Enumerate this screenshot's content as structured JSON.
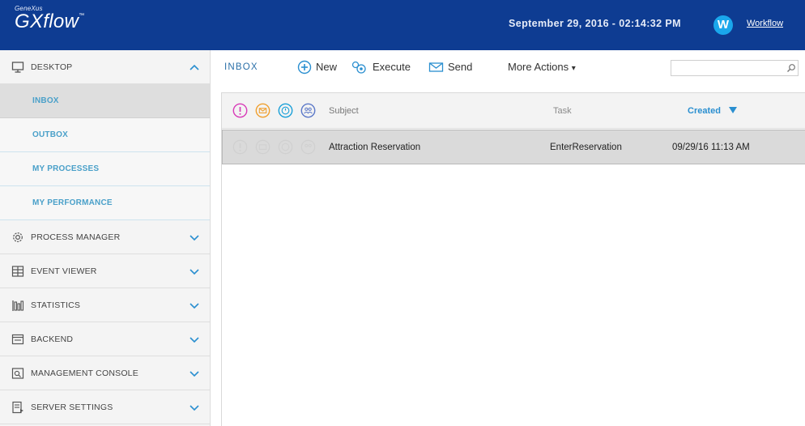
{
  "header": {
    "brand_small": "GeneXus",
    "app_name": "GXflow",
    "trademark": "™",
    "datetime": "September 29, 2016 - 02:14:32 PM",
    "avatar_letter": "W",
    "user_link": "Workflow",
    "bg_color": "#0e3c92",
    "avatar_color": "#1aa7ec"
  },
  "sidebar": {
    "desktop": {
      "label": "DESKTOP",
      "icon": "monitor-icon",
      "expanded": true
    },
    "subitems": [
      {
        "label": "INBOX",
        "active": true
      },
      {
        "label": "OUTBOX",
        "active": false
      },
      {
        "label": "MY PROCESSES",
        "active": false
      },
      {
        "label": "MY PERFORMANCE",
        "active": false
      }
    ],
    "items": [
      {
        "label": "PROCESS MANAGER",
        "icon": "gear-icon"
      },
      {
        "label": "EVENT VIEWER",
        "icon": "event-viewer-icon"
      },
      {
        "label": "STATISTICS",
        "icon": "statistics-icon"
      },
      {
        "label": "BACKEND",
        "icon": "backend-icon"
      },
      {
        "label": "MANAGEMENT CONSOLE",
        "icon": "console-icon"
      },
      {
        "label": "SERVER SETTINGS",
        "icon": "server-settings-icon"
      }
    ]
  },
  "toolbar": {
    "title": "INBOX",
    "new_label": "New",
    "execute_label": "Execute",
    "send_label": "Send",
    "more_actions_label": "More Actions",
    "more_actions_caret": "▾",
    "search_placeholder": ""
  },
  "grid": {
    "columns": {
      "subject": "Subject",
      "task": "Task",
      "created": "Created"
    },
    "sort_indicator": "descending",
    "header_icons": [
      "priority-icon",
      "message-icon",
      "timer-icon",
      "participants-icon"
    ],
    "header_icon_colors": [
      "#d83bb8",
      "#f0a030",
      "#1aa0d8",
      "#5b78c8"
    ],
    "rows": [
      {
        "subject": "Attraction Reservation",
        "task": "EnterReservation",
        "created": "09/29/16 11:13 AM"
      }
    ]
  }
}
